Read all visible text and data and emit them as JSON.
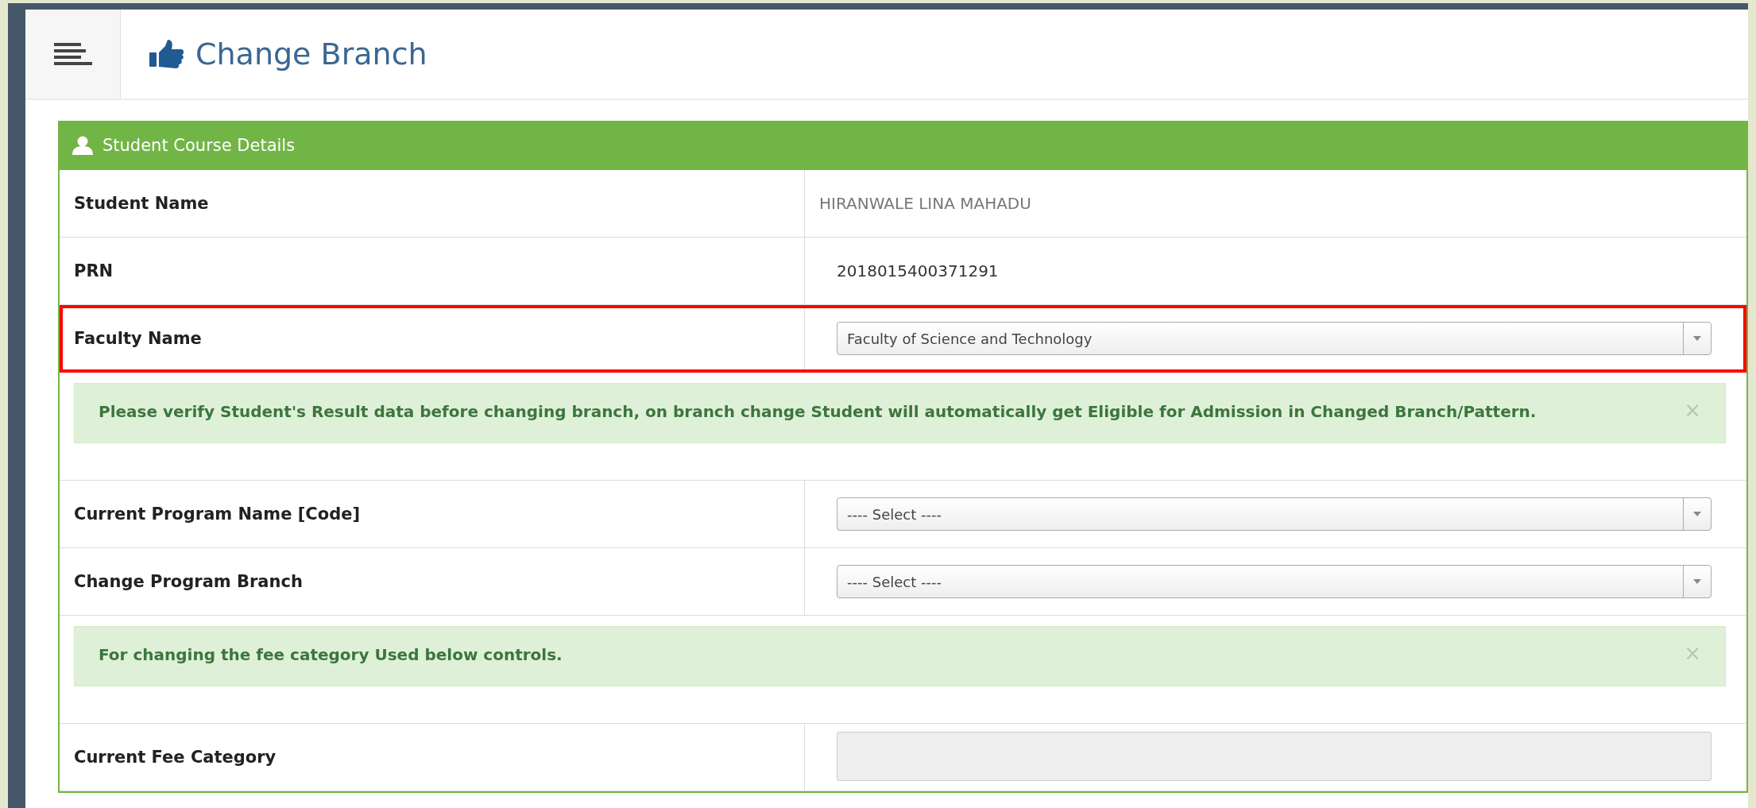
{
  "header": {
    "title": "Change Branch"
  },
  "panel": {
    "title": "Student Course Details",
    "rows": [
      {
        "kind": "text",
        "label": "Student Name",
        "value": "HIRANWALE LINA MAHADU"
      },
      {
        "kind": "text",
        "label": "PRN",
        "value": "2018015400371291"
      },
      {
        "kind": "select",
        "label": "Faculty Name",
        "value": "Faculty of Science and Technology",
        "highlighted": true
      },
      {
        "kind": "alert",
        "text": "Please verify Student's Result data before changing branch, on branch change Student will automatically get Eligible for Admission in Changed Branch/Pattern.",
        "close": "×"
      },
      {
        "kind": "select",
        "label": "Current Program Name [Code]",
        "value": "---- Select ----",
        "highlighted": false
      },
      {
        "kind": "select",
        "label": "Change Program Branch",
        "value": "---- Select ----",
        "highlighted": false
      },
      {
        "kind": "alert",
        "text": "For changing the fee category Used below controls.",
        "close": "×"
      },
      {
        "kind": "readonly",
        "label": "Current Fee Category"
      }
    ]
  }
}
